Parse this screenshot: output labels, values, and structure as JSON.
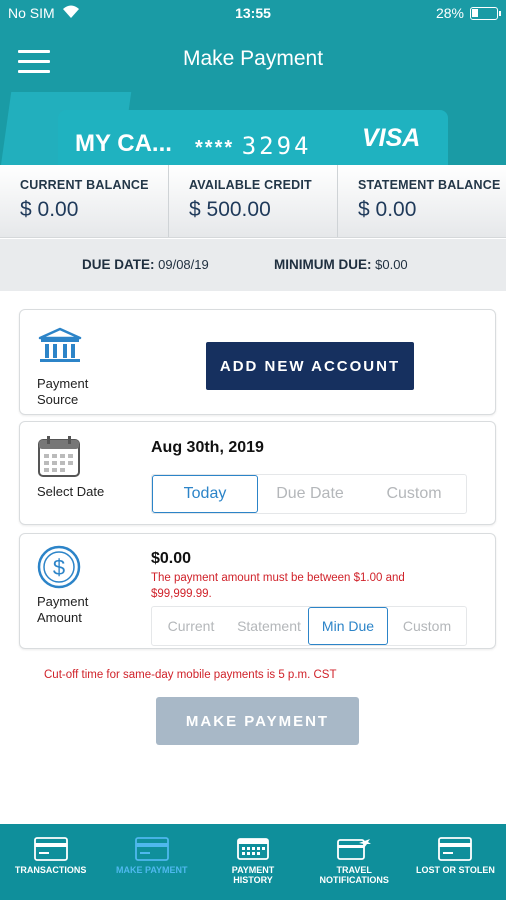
{
  "status_bar": {
    "carrier": "No SIM",
    "time": "13:55",
    "battery": "28%",
    "battery_level": 0.28
  },
  "header": {
    "title": "Make Payment",
    "menu_icon": "hamburger-menu-icon"
  },
  "card": {
    "name": "MY CA...",
    "number_mask": "****",
    "last4": "3294",
    "brand": "VISA"
  },
  "balances": [
    {
      "label": "CURRENT BALANCE",
      "value": "$ 0.00"
    },
    {
      "label": "AVAILABLE CREDIT",
      "value": "$ 500.00"
    },
    {
      "label": "STATEMENT BALANCE",
      "value": "$ 0.00"
    }
  ],
  "due": {
    "due_date_label": "DUE DATE:",
    "due_date": "09/08/19",
    "min_due_label": "MINIMUM DUE:",
    "min_due": "$0.00"
  },
  "payment_source": {
    "label": "Payment Source",
    "label_line1": "Payment",
    "label_line2": "Source",
    "icon": "bank-icon",
    "button": "ADD NEW ACCOUNT"
  },
  "select_date": {
    "label": "Select Date",
    "icon": "calendar-icon",
    "value": "Aug 30th, 2019",
    "options": [
      "Today",
      "Due Date",
      "Custom"
    ],
    "selected": "Today"
  },
  "payment_amount": {
    "label_line1": "Payment",
    "label_line2": "Amount",
    "icon": "dollar-coin-icon",
    "value": "$0.00",
    "warning": "The payment amount must be between $1.00 and $99,999.99.",
    "options": [
      "Current",
      "Statement",
      "Min Due",
      "Custom"
    ],
    "selected": "Min Due"
  },
  "cutoff_note": "Cut-off time for same-day mobile payments is 5 p.m. CST",
  "make_payment_button": "MAKE PAYMENT",
  "tabs": [
    {
      "label": "TRANSACTIONS",
      "icon": "card-icon",
      "active": false
    },
    {
      "label": "MAKE PAYMENT",
      "icon": "card-icon",
      "active": true
    },
    {
      "label_line1": "PAYMENT",
      "label_line2": "HISTORY",
      "icon": "calendar-grid-icon",
      "active": false
    },
    {
      "label_line1": "TRAVEL",
      "label_line2": "NOTIFICATIONS",
      "icon": "card-plane-icon",
      "active": false
    },
    {
      "label": "LOST OR STOLEN",
      "icon": "card-icon",
      "active": false
    }
  ],
  "colors": {
    "header": "#1a9ba5",
    "navy_button": "#16305f",
    "disabled_button": "#a8b8c7",
    "tabbar": "#0f8f9b",
    "active_tab": "#4fb8ee",
    "warning": "#d0222a",
    "selected_option": "#2c84c8"
  }
}
